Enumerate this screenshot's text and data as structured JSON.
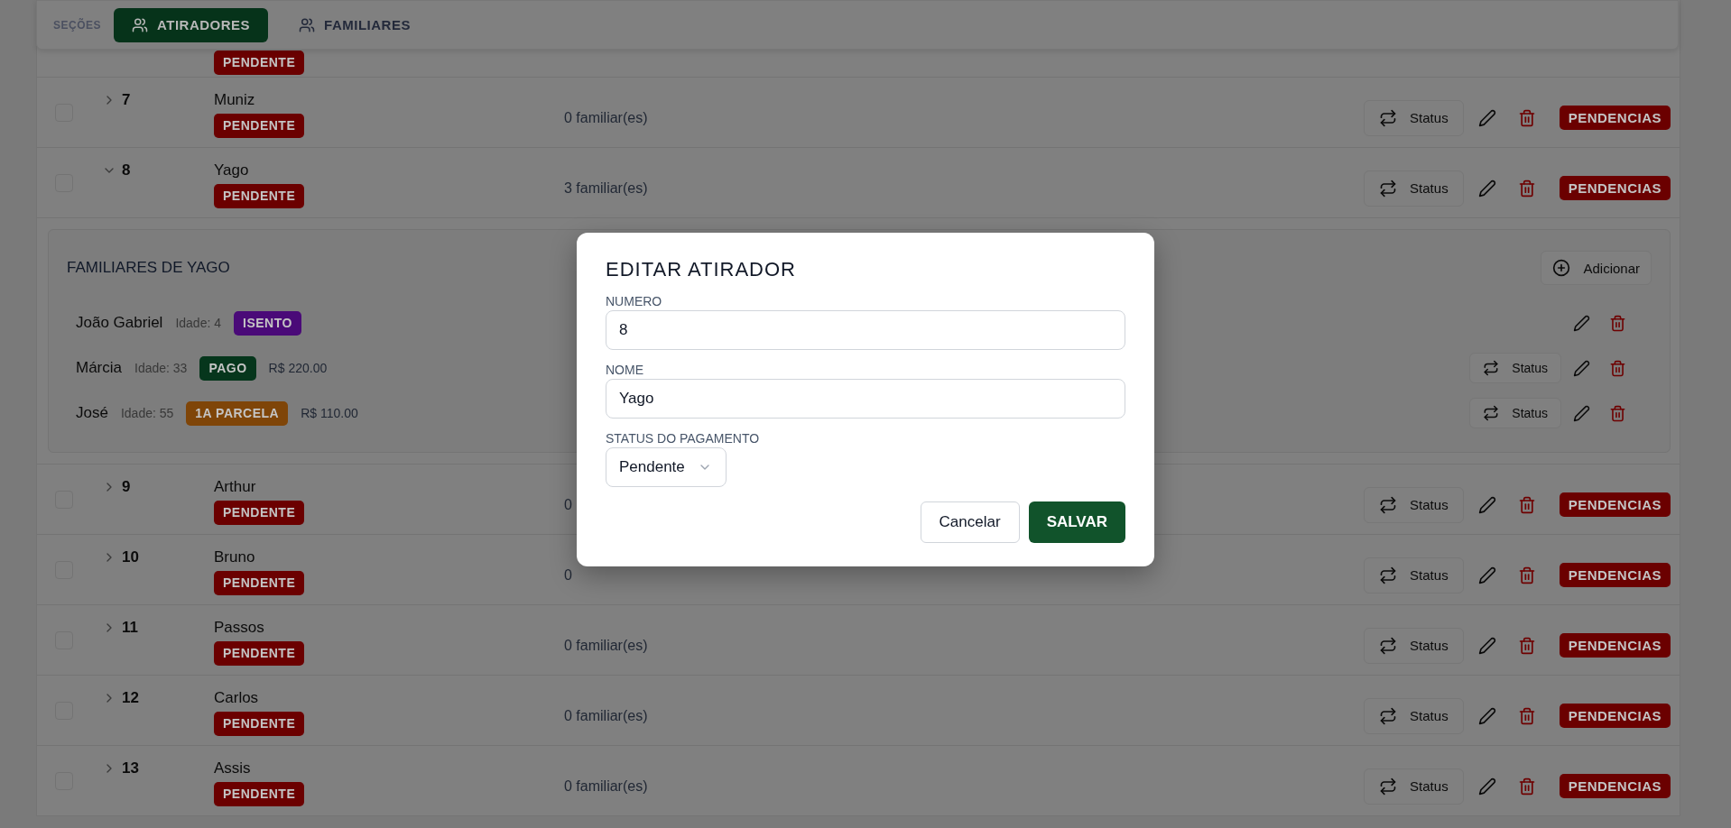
{
  "section_nav": {
    "label": "SEÇÕES",
    "tabs": [
      {
        "label": "ATIRADORES",
        "selected": true
      },
      {
        "label": "FAMILIARES",
        "selected": false
      }
    ]
  },
  "atiradores": [
    {
      "badge": {
        "label": "PENDENTE",
        "color": "#6b0000"
      }
    },
    {
      "number": "7",
      "name": "Muniz",
      "checked": false,
      "expanded": false,
      "badge": {
        "label": "PENDENTE",
        "color": "#6b0000"
      },
      "familiares_count": "0 familiar(es)",
      "status_button": "Status",
      "pendencias": "PENDENCIAS"
    },
    {
      "number": "8",
      "name": "Yago",
      "checked": false,
      "expanded": true,
      "badge": {
        "label": "PENDENTE",
        "color": "#6b0000"
      },
      "familiares_count": "3 familiar(es)",
      "status_button": "Status",
      "pendencias": "PENDENCIAS",
      "familiares": {
        "title": "FAMILIARES DE YAGO",
        "add_button": "Adicionar",
        "members": [
          {
            "name": "João Gabriel",
            "age": "Idade: 4",
            "badge": {
              "label": "ISENTO",
              "color": "#4a0a78"
            }
          },
          {
            "name": "Márcia",
            "age": "Idade: 33",
            "badge": {
              "label": "PAGO",
              "color": "#06361c"
            },
            "amount": "R$ 220.00",
            "status_button": "Status"
          },
          {
            "name": "José",
            "age": "Idade: 55",
            "badge": {
              "label": "1A PARCELA",
              "color": "#7f4508"
            },
            "amount": "R$ 110.00",
            "status_button": "Status"
          }
        ]
      }
    },
    {
      "number": "9",
      "name": "Arthur",
      "checked": false,
      "expanded": false,
      "badge": {
        "label": "PENDENTE",
        "color": "#6b0000"
      },
      "familiares_count": "0",
      "status_button": "Status",
      "pendencias": "PENDENCIAS"
    },
    {
      "number": "10",
      "name": "Bruno",
      "checked": false,
      "expanded": false,
      "badge": {
        "label": "PENDENTE",
        "color": "#6b0000"
      },
      "familiares_count": "0",
      "status_button": "Status",
      "pendencias": "PENDENCIAS"
    },
    {
      "number": "11",
      "name": "Passos",
      "checked": false,
      "expanded": false,
      "badge": {
        "label": "PENDENTE",
        "color": "#6b0000"
      },
      "familiares_count": "0 familiar(es)",
      "status_button": "Status",
      "pendencias": "PENDENCIAS"
    },
    {
      "number": "12",
      "name": "Carlos",
      "checked": false,
      "expanded": false,
      "badge": {
        "label": "PENDENTE",
        "color": "#6b0000"
      },
      "familiares_count": "0 familiar(es)",
      "status_button": "Status",
      "pendencias": "PENDENCIAS"
    },
    {
      "number": "13",
      "name": "Assis",
      "checked": false,
      "expanded": false,
      "badge": {
        "label": "PENDENTE",
        "color": "#6b0000"
      },
      "familiares_count": "0 familiar(es)",
      "status_button": "Status",
      "pendencias": "PENDENCIAS"
    }
  ],
  "modal": {
    "title": "EDITAR ATIRADOR",
    "fields": [
      {
        "kind": "text",
        "label": "NUMERO",
        "value": "8"
      },
      {
        "kind": "text",
        "label": "NOME",
        "value": "Yago"
      },
      {
        "kind": "select",
        "label": "STATUS DO PAGAMENTO",
        "value": "Pendente"
      }
    ],
    "buttons": [
      {
        "kind": "secondary",
        "label": "Cancelar"
      },
      {
        "kind": "primary",
        "label": "SALVAR"
      }
    ]
  }
}
